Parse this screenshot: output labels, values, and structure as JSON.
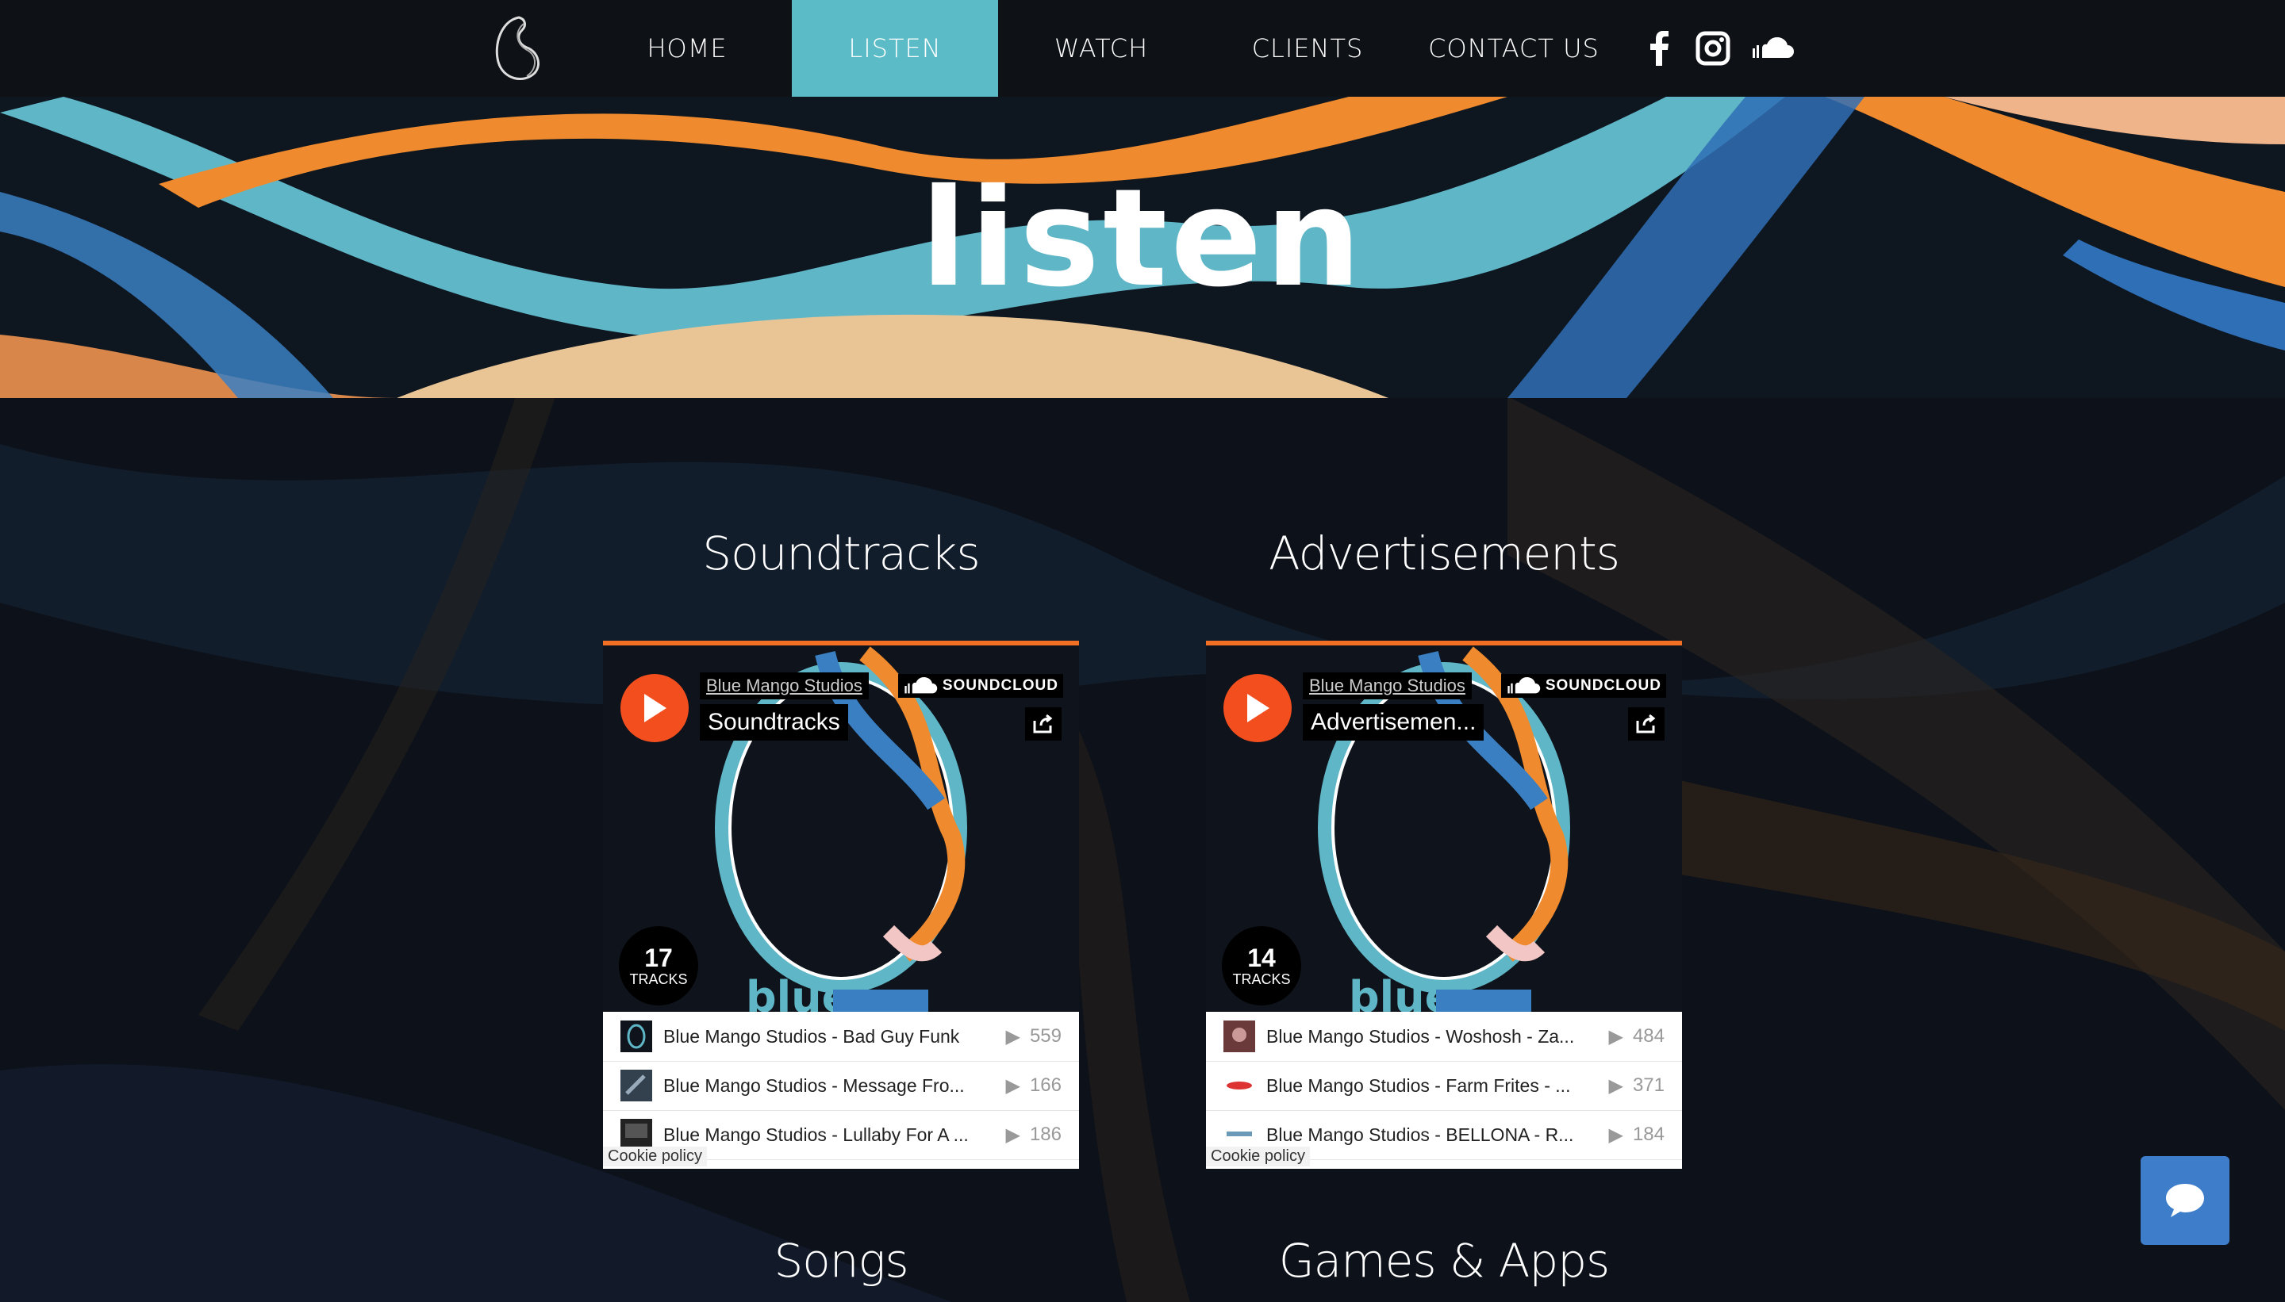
{
  "nav": {
    "items": [
      {
        "label": "HOME",
        "active": false
      },
      {
        "label": "LISTEN",
        "active": true
      },
      {
        "label": "WATCH",
        "active": false
      },
      {
        "label": "CLIENTS",
        "active": false
      },
      {
        "label": "CONTACT US",
        "active": false
      }
    ],
    "social_icons": [
      "facebook-icon",
      "instagram-icon",
      "soundcloud-icon"
    ],
    "active_color": "#5bbcc8"
  },
  "hero": {
    "title": "listen"
  },
  "sections": {
    "soundtracks": "Soundtracks",
    "advertisements": "Advertisements",
    "songs": "Songs",
    "games_apps": "Games & Apps"
  },
  "widgets": [
    {
      "artist": "Blue Mango Studios",
      "brand": "SOUNDCLOUD",
      "playlist": "Soundtracks",
      "track_count": "17",
      "tracks_label": "TRACKS",
      "tracks": [
        {
          "title": "Blue Mango Studios - Bad Guy Funk",
          "plays": "559"
        },
        {
          "title": "Blue Mango Studios - Message Fro...",
          "plays": "166"
        },
        {
          "title": "Blue Mango Studios - Lullaby For A ...",
          "plays": "186"
        }
      ],
      "cookie": "Cookie policy"
    },
    {
      "artist": "Blue Mango Studios",
      "brand": "SOUNDCLOUD",
      "playlist": "Advertisemen...",
      "track_count": "14",
      "tracks_label": "TRACKS",
      "tracks": [
        {
          "title": "Blue Mango Studios - Woshosh - Za...",
          "plays": "484"
        },
        {
          "title": "Blue Mango Studios - Farm Frites - ...",
          "plays": "371"
        },
        {
          "title": "Blue Mango Studios - BELLONA - R...",
          "plays": "184"
        }
      ],
      "cookie": "Cookie policy"
    }
  ],
  "colors": {
    "accent_orange": "#f26f23",
    "play_red": "#f24e1e",
    "chat_blue": "#3d7dca",
    "teal": "#5bbcc8"
  }
}
